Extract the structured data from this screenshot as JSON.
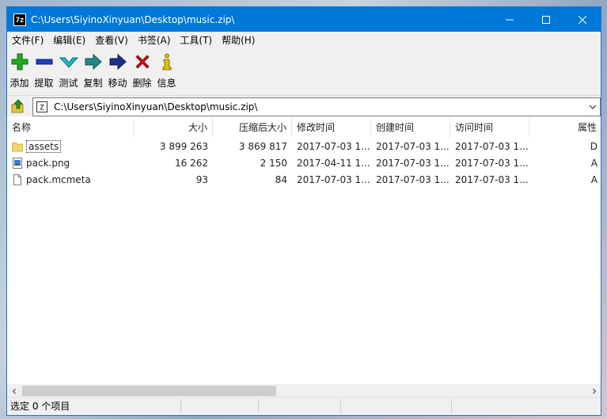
{
  "window": {
    "title": "C:\\Users\\SiyinoXinyuan\\Desktop\\music.zip\\",
    "app_icon_text": "7z"
  },
  "menu": [
    {
      "label": "文件(F)"
    },
    {
      "label": "编辑(E)"
    },
    {
      "label": "查看(V)"
    },
    {
      "label": "书签(A)"
    },
    {
      "label": "工具(T)"
    },
    {
      "label": "帮助(H)"
    }
  ],
  "toolbar": [
    {
      "label": "添加",
      "icon": "plus-icon",
      "color": "#1faa1f"
    },
    {
      "label": "提取",
      "icon": "minus-icon",
      "color": "#1f3fbf"
    },
    {
      "label": "测试",
      "icon": "check-chevron-icon",
      "color": "#1fb8c8"
    },
    {
      "label": "复制",
      "icon": "copy-arrow-icon",
      "color": "#1f8a8a"
    },
    {
      "label": "移动",
      "icon": "move-arrow-icon",
      "color": "#1f2f8f"
    },
    {
      "label": "删除",
      "icon": "delete-x-icon",
      "color": "#d01010"
    },
    {
      "label": "信息",
      "icon": "info-icon",
      "color": "#e0c000"
    }
  ],
  "address": {
    "path": "C:\\Users\\SiyinoXinyuan\\Desktop\\music.zip\\"
  },
  "columns": [
    "名称",
    "大小",
    "压缩后大小",
    "修改时间",
    "创建时间",
    "访问时间",
    "属性"
  ],
  "files": [
    {
      "name": "assets",
      "type": "folder",
      "size": "3 899 263",
      "packed": "3 869 817",
      "modified": "2017-07-03 1...",
      "created": "2017-07-03 1...",
      "accessed": "2017-07-03 1...",
      "attr": "D"
    },
    {
      "name": "pack.png",
      "type": "image",
      "size": "16 262",
      "packed": "2 150",
      "modified": "2017-04-11 1...",
      "created": "2017-07-03 1...",
      "accessed": "2017-07-03 1...",
      "attr": "A"
    },
    {
      "name": "pack.mcmeta",
      "type": "file",
      "size": "93",
      "packed": "84",
      "modified": "2017-07-03 1...",
      "created": "2017-07-03 1...",
      "accessed": "2017-07-03 1...",
      "attr": "A"
    }
  ],
  "status": {
    "selected": "选定 0 个项目"
  },
  "colors": {
    "titlebar": "#0078d7",
    "chrome": "#f0f0f0"
  }
}
